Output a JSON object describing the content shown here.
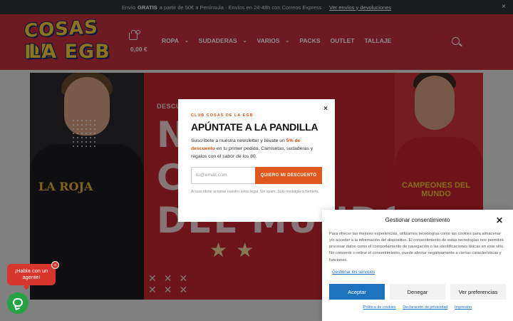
{
  "topbar": {
    "prefix": "Envío",
    "bold": "GRATIS",
    "text": "a partir de 50€ a Península · Envíos en 24-48h con Correos Express ·",
    "link": "Ver envíos y devoluciones",
    "close": "×"
  },
  "header": {
    "logo_line1": "COSAS DE",
    "logo_line2": "LA EGB",
    "cart_total": "0,00 €",
    "nav": [
      {
        "label": "ROPA",
        "dropdown": true
      },
      {
        "label": "SUDADERAS",
        "dropdown": true
      },
      {
        "label": "VARIOS",
        "dropdown": true
      },
      {
        "label": "PACKS",
        "dropdown": false
      },
      {
        "label": "OUTLET",
        "dropdown": false
      },
      {
        "label": "TALLAJE",
        "dropdown": false
      }
    ]
  },
  "hero": {
    "kicker": "DESCU",
    "line1": "NA",
    "line2": "CA",
    "line3": "DEL MUNDO",
    "stars": "★★",
    "left_shirt_text": "LA ROJA",
    "right_shirt_text": "CAMPEONES DEL MUNDO"
  },
  "modal": {
    "close": "×",
    "kicker": "CLUB COSAS DE LA EGB",
    "title": "APÚNTATE A LA PANDILLA",
    "body_before": "Suscríbete a nuestra newsletter y llévate un",
    "body_highlight": "5% de descuento",
    "body_after": "en tu primer pedido. Camisetas, sudaderas y regalos con el sabor de los 80.",
    "input_placeholder": "tu@email.com",
    "button": "QUIERO MI DESCUENTO",
    "legal": "Al suscribirte aceptas nuestro aviso legal. Sin spam. Solo nostalgia ochentera."
  },
  "cookie": {
    "title": "Gestionar consentimiento",
    "close": "✕",
    "text": "Para ofrecer las mejores experiencias, utilizamos tecnologías como las cookies para almacenar y/o acceder a la información del dispositivo. El consentimiento de estas tecnologías nos permitirá procesar datos como el comportamiento de navegación o las identificaciones únicas en este sitio. No consentir o retirar el consentimiento, puede afectar negativamente a ciertas características y funciones.",
    "manage": "Gestionar los servicios",
    "accept": "Aceptar",
    "deny": "Denegar",
    "prefs": "Ver preferencias",
    "links": [
      "Política de cookies",
      "Declaración de privacidad",
      "Impresión"
    ]
  },
  "chat": {
    "bubble": "¡Habla con un agente!",
    "close": "×"
  }
}
